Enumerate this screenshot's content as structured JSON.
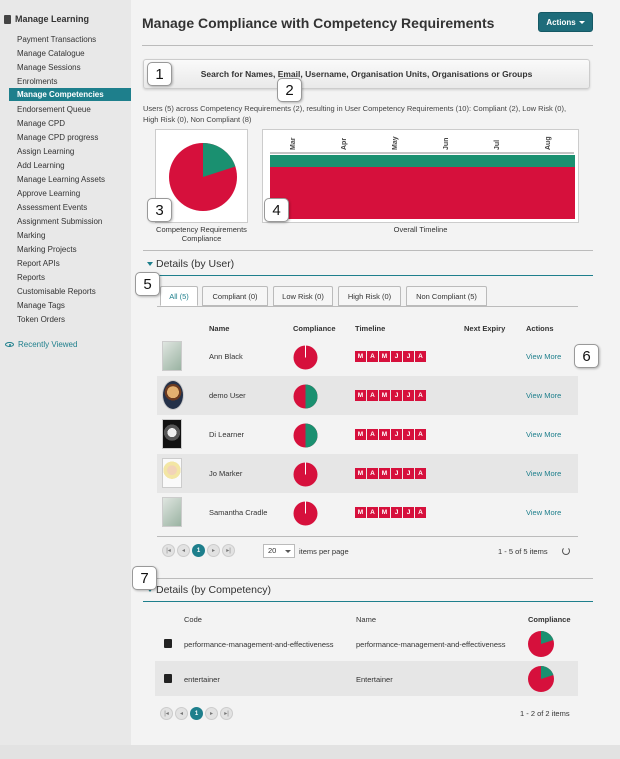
{
  "colors": {
    "accent": "#1e7f8c",
    "compliant": "#1a9070",
    "noncompliant": "#d6103c"
  },
  "sidebar": {
    "heading": "Manage Learning",
    "items": [
      "Payment Transactions",
      "Manage Catalogue",
      "Manage Sessions",
      "Enrolments",
      "Manage Competencies",
      "Endorsement Queue",
      "Manage CPD",
      "Manage CPD progress",
      "Assign Learning",
      "Add Learning",
      "Manage Learning Assets",
      "Approve Learning",
      "Assessment Events",
      "Assignment Submission",
      "Marking",
      "Marking Projects",
      "Report APIs",
      "Reports",
      "Customisable Reports",
      "Manage Tags",
      "Token Orders"
    ],
    "active_index": 4,
    "recently_viewed": "Recently Viewed"
  },
  "header": {
    "title": "Manage Compliance with Competency Requirements",
    "actions_label": "Actions"
  },
  "search": {
    "label": "Search for Names, Email, Username, Organisation Units, Organisations or Groups"
  },
  "summary": "Users (5) across Competency Requirements (2), resulting in User Competency Requirements (10): Compliant (2), Low Risk (0), High Risk (0), Non Compliant (8)",
  "overview": {
    "pie_caption": "Competency Requirements Compliance",
    "pie_compliant_fraction": 0.2,
    "timeline_caption": "Overall Timeline",
    "timeline_months": [
      "Mar",
      "Apr",
      "May",
      "Jun",
      "Jul",
      "Aug"
    ]
  },
  "callouts": [
    "1",
    "2",
    "3",
    "4",
    "5",
    "6",
    "7"
  ],
  "by_user": {
    "heading": "Details (by User)",
    "tabs": [
      "All (5)",
      "Compliant (0)",
      "Low Risk (0)",
      "High Risk (0)",
      "Non Compliant (5)"
    ],
    "columns": [
      "Name",
      "Compliance",
      "Timeline",
      "Next Expiry",
      "Actions"
    ],
    "rows": [
      {
        "name": "Ann Black",
        "compliant_fraction": 0,
        "timeline": [
          "M",
          "A",
          "M",
          "J",
          "J",
          "A"
        ],
        "action": "View More"
      },
      {
        "name": "demo User",
        "compliant_fraction": 0.5,
        "timeline": [
          "M",
          "A",
          "M",
          "J",
          "J",
          "A"
        ],
        "action": "View More"
      },
      {
        "name": "Di Learner",
        "compliant_fraction": 0.5,
        "timeline": [
          "M",
          "A",
          "M",
          "J",
          "J",
          "A"
        ],
        "action": "View More"
      },
      {
        "name": "Jo Marker",
        "compliant_fraction": 0,
        "timeline": [
          "M",
          "A",
          "M",
          "J",
          "J",
          "A"
        ],
        "action": "View More"
      },
      {
        "name": "Samantha Cradle",
        "compliant_fraction": 0,
        "timeline": [
          "M",
          "A",
          "M",
          "J",
          "J",
          "A"
        ],
        "action": "View More"
      }
    ],
    "pager": {
      "current": "1",
      "per_page": "20",
      "per_page_label": "items per page",
      "range": "1 - 5 of 5 items"
    }
  },
  "by_competency": {
    "heading": "Details (by Competency)",
    "columns": [
      "Code",
      "Name",
      "Compliance"
    ],
    "rows": [
      {
        "code": "performance-management-and-effectiveness",
        "name": "performance-management-and-effectiveness",
        "compliant_fraction": 0.2
      },
      {
        "code": "entertainer",
        "name": "Entertainer",
        "compliant_fraction": 0.2
      }
    ],
    "pager": {
      "current": "1",
      "range": "1 - 2 of 2 items"
    }
  }
}
